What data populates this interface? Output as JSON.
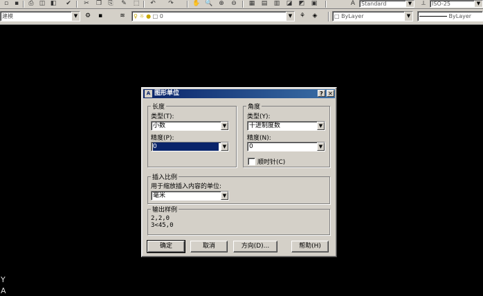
{
  "toolbar_top": {
    "text_style": "Standard",
    "dim_style": "ISO-25"
  },
  "toolbar_layers": {
    "workspace": "建模",
    "layer_name": "0",
    "color_combo": "ByLayer",
    "linetype_combo": "ByLayer"
  },
  "ucs": {
    "y_label": "Y",
    "a_label": "A"
  },
  "dialog": {
    "title": "图形单位",
    "help_btn": "?",
    "close_btn": "✕",
    "length": {
      "legend": "长度",
      "type_label": "类型(T):",
      "type_value": "小数",
      "precision_label": "精度(P):",
      "precision_value": "0"
    },
    "angle": {
      "legend": "角度",
      "type_label": "类型(Y):",
      "type_value": "十进制度数",
      "precision_label": "精度(N):",
      "precision_value": "0",
      "clockwise_label": "顺时针(C)",
      "clockwise_checked": false
    },
    "insert_scale": {
      "legend": "插入比例",
      "units_label": "用于缩放插入内容的单位:",
      "units_value": "毫米"
    },
    "sample": {
      "legend": "输出样例",
      "line1": "2,2,0",
      "line2": "3<45,0"
    },
    "buttons": {
      "ok": "确定",
      "cancel": "取消",
      "direction": "方向(D)...",
      "help": "帮助(H)"
    }
  },
  "colors": {
    "titlebar": "#0a246a",
    "face": "#d4d0c8",
    "canvas": "#000000"
  }
}
